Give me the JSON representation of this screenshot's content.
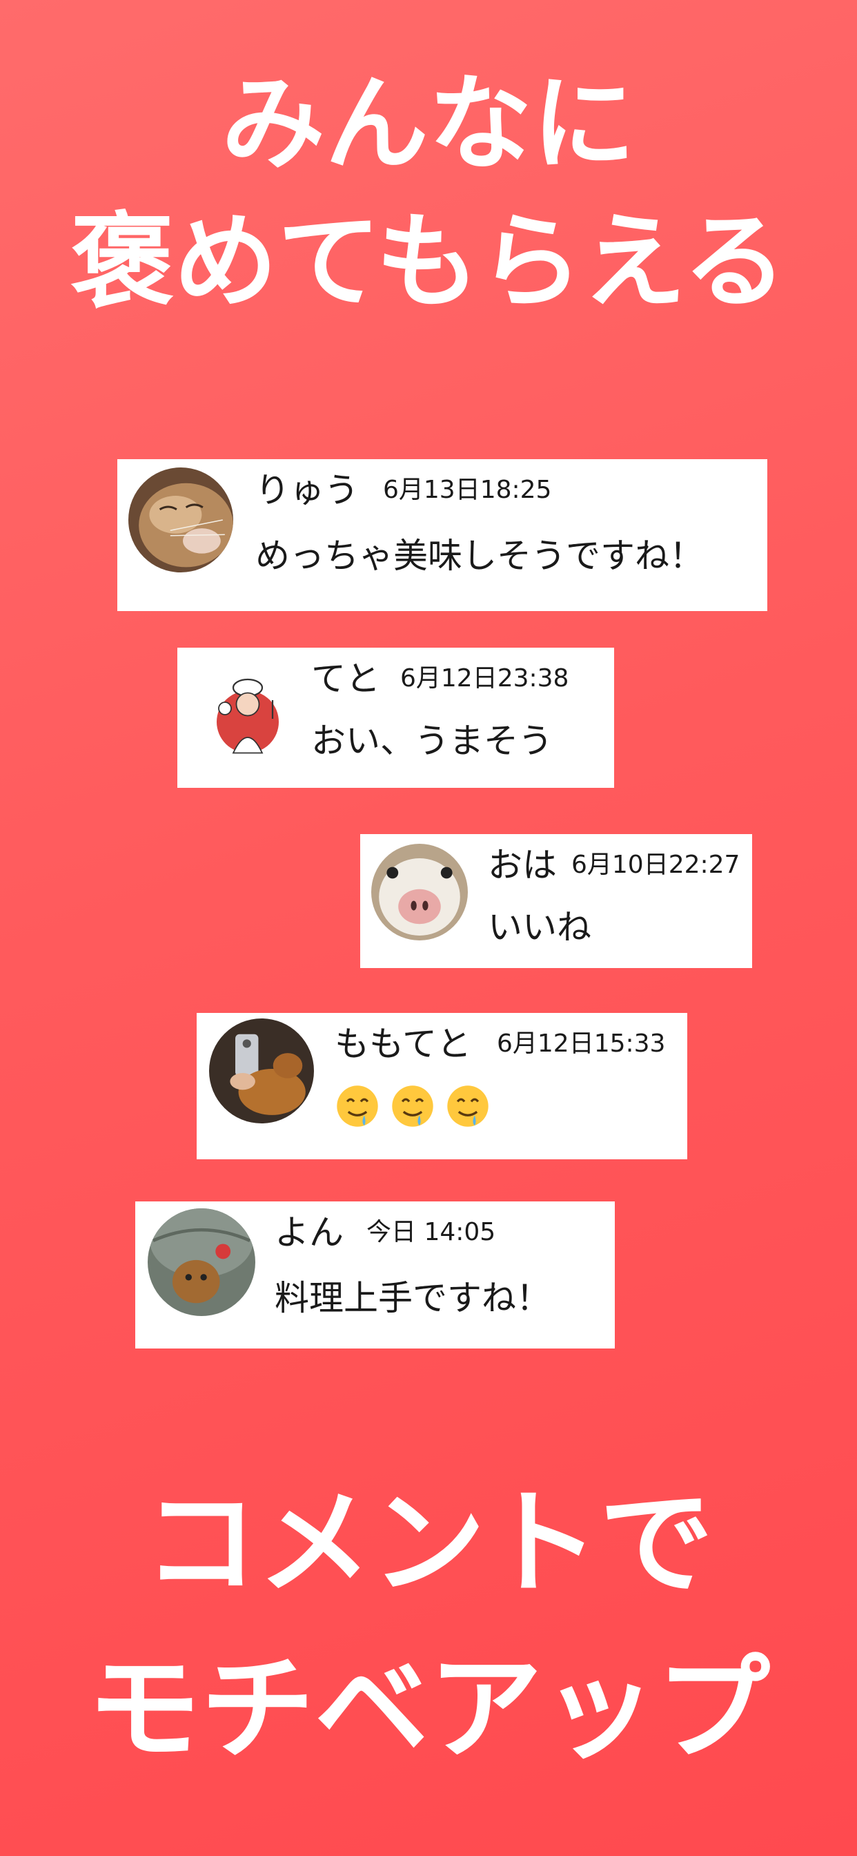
{
  "headline_top": {
    "line1": "みんなに",
    "line2": "褒めてもらえる"
  },
  "headline_bottom": {
    "line1": "コメントで",
    "line2": "モチベアップ"
  },
  "colors": {
    "background": "#ff5a5c",
    "card": "#ffffff",
    "text": "#1a1a1a",
    "headline": "#ffffff"
  },
  "comments": [
    {
      "name": "りゅう",
      "time": "6月13日18:25",
      "text": "めっちゃ美味しそうですね！",
      "avatar": "cat-closeup-avatar"
    },
    {
      "name": "てと",
      "time": "6月12日23:38",
      "text": "おい、うまそう",
      "avatar": "chef-illustration-avatar"
    },
    {
      "name": "おは",
      "time": "6月10日22:27",
      "text": "いいね",
      "avatar": "cat-nose-avatar"
    },
    {
      "name": "ももてと",
      "time": "6月12日15:33",
      "text": "🤤🤤🤤",
      "avatar": "selfie-with-cat-avatar",
      "emoji_count": 3,
      "emoji_icon": "drooling-face-icon"
    },
    {
      "name": "よん",
      "time": "今日 14:05",
      "text": "料理上手ですね！",
      "avatar": "cat-in-hat-avatar"
    }
  ]
}
